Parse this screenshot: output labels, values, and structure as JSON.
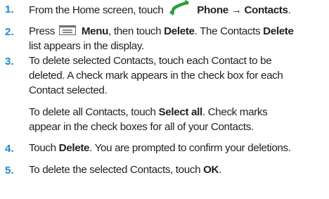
{
  "steps": [
    {
      "number": "1.",
      "text_a": "From the Home screen, touch",
      "icon": "phone-icon",
      "bold_a": "Phone → Contacts",
      "text_b": "."
    },
    {
      "number": "2.",
      "text_a": "Press",
      "icon": "menu-icon",
      "bold_a": "Menu",
      "text_b": ", then touch",
      "bold_b": "Delete",
      "text_c": ". The Contacts",
      "bold_c": "Delete",
      "line2": "list appears in the display."
    },
    {
      "number": "3.",
      "line1": "To delete selected Contacts, touch each Contact to be",
      "line2": "deleted. A check mark appears in the check box for each",
      "line3": "Contact selected.",
      "para2_text_a": "To delete all Contacts, touch",
      "para2_bold": "Select all",
      "para2_text_b": ". Check marks",
      "para2_line2": "appear in the check boxes for all of your Contacts."
    },
    {
      "number": "4.",
      "text_a": "Touch",
      "bold_a": "Delete",
      "text_b": ". You are prompted to confirm your deletions."
    },
    {
      "number": "5.",
      "text_a": "To delete the selected Contacts, touch",
      "bold_a": "OK",
      "text_b": "."
    }
  ],
  "colors": {
    "number": "#1e88c7",
    "text": "#231f20",
    "phone_icon": "#2e9e3a"
  }
}
